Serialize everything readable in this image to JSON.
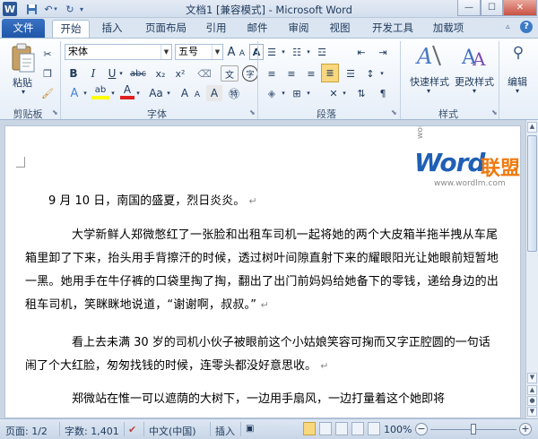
{
  "window": {
    "title": "文档1 [兼容模式] - Microsoft Word",
    "app_icon": "W"
  },
  "tabs": [
    "文件",
    "开始",
    "插入",
    "页面布局",
    "引用",
    "邮件",
    "审阅",
    "视图",
    "开发工具",
    "加载项"
  ],
  "active_tab": "开始",
  "ribbon": {
    "clipboard": {
      "paste": "粘贴",
      "group": "剪贴板"
    },
    "font": {
      "name": "宋体",
      "size": "五号",
      "group": "字体",
      "grow": "A",
      "shrink": "A",
      "bold": "B",
      "italic": "I",
      "underline": "U",
      "strike": "abc",
      "sub": "x₂",
      "sup": "x²",
      "highlight": "ab",
      "font_color": "A",
      "char_scale": "Aa",
      "clear": "A",
      "phonetic": "文",
      "enclose": "字"
    },
    "paragraph": {
      "group": "段落"
    },
    "styles": {
      "quick": "快速样式",
      "change": "更改样式",
      "group": "样式"
    },
    "editing": {
      "label": "编辑"
    }
  },
  "document": {
    "paragraphs": [
      "9 月 10 日，南国的盛夏，烈日炎炎。",
      "大学新鲜人郑微憋红了一张脸和出租车司机一起将她的两个大皮箱半拖半拽从车尾箱里卸了下来，抬头用手背擦汗的时候，透过树叶间隙直射下来的耀眼阳光让她眼前短暂地一黑。她用手在牛仔裤的口袋里掏了掏，翻出了出门前妈妈给她备下的零钱，递给身边的出租车司机，笑眯眯地说道，“谢谢啊，叔叔。”",
      "看上去未满  30 岁的司机小伙子被眼前这个小姑娘笑容可掬而又字正腔圆的一句话闹了个大红脸，匆匆找钱的时候，连零头都没好意思收。",
      "郑微站在惟一可以遮荫的大树下，一边用手扇风，一边打量着这个她即将"
    ],
    "para_mark": "↵",
    "watermark": {
      "word": "Word",
      "cn": "联盟",
      "url": "www.wordlm.com",
      "corner": "wordlm.com"
    }
  },
  "status": {
    "page": "页面: 1/2",
    "words": "字数: 1,401",
    "lang": "中文(中国)",
    "mode": "插入",
    "zoom": "100%",
    "zoom_level": 1.0
  },
  "colors": {
    "highlight": "#ffff00",
    "font_color": "#e02020",
    "word_blue": "#1f5fb4",
    "lianmeng_orange": "#f07a10"
  }
}
